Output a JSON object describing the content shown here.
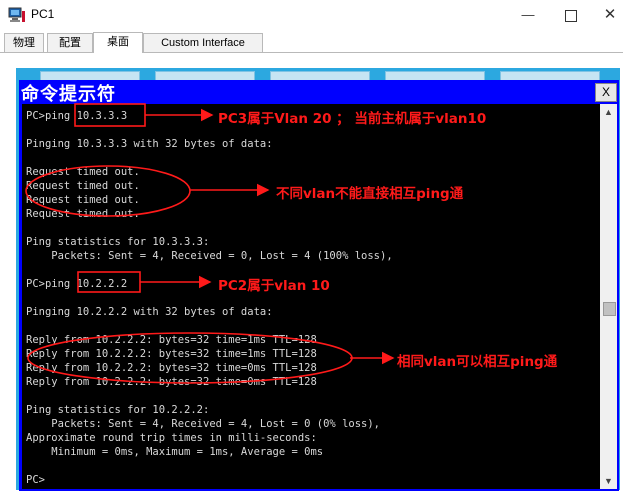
{
  "window": {
    "title": "PC1",
    "minimize_glyph": "—",
    "close_glyph": "✕"
  },
  "tabs": [
    {
      "label": "物理",
      "active": false
    },
    {
      "label": "配置",
      "active": false
    },
    {
      "label": "桌面",
      "active": true
    },
    {
      "label": "Custom Interface",
      "active": false
    }
  ],
  "console": {
    "title": "命令提示符",
    "close_label": "X",
    "lines": [
      "PC>ping 10.3.3.3",
      "",
      "Pinging 10.3.3.3 with 32 bytes of data:",
      "",
      "Request timed out.",
      "Request timed out.",
      "Request timed out.",
      "Request timed out.",
      "",
      "Ping statistics for 10.3.3.3:",
      "    Packets: Sent = 4, Received = 0, Lost = 4 (100% loss),",
      "",
      "PC>ping 10.2.2.2",
      "",
      "Pinging 10.2.2.2 with 32 bytes of data:",
      "",
      "Reply from 10.2.2.2: bytes=32 time=1ms TTL=128",
      "Reply from 10.2.2.2: bytes=32 time=1ms TTL=128",
      "Reply from 10.2.2.2: bytes=32 time=0ms TTL=128",
      "Reply from 10.2.2.2: bytes=32 time=0ms TTL=128",
      "",
      "Ping statistics for 10.2.2.2:",
      "    Packets: Sent = 4, Received = 4, Lost = 0 (0% loss),",
      "Approximate round trip times in milli-seconds:",
      "    Minimum = 0ms, Maximum = 1ms, Average = 0ms",
      "",
      "PC>"
    ]
  },
  "annotations": {
    "pc3_note": "PC3属于Vlan 20  ；  当前主机属于vlan10",
    "diff_vlan_note": "不同vlan不能直接相互ping通",
    "pc2_note": "PC2属于vlan 10",
    "same_vlan_note": "相同vlan可以相互ping通",
    "color": "#ff1a1a"
  },
  "colors": {
    "console_frame": "#0000ff",
    "terminal_bg": "#000000",
    "terminal_text": "#d8d8d8"
  }
}
